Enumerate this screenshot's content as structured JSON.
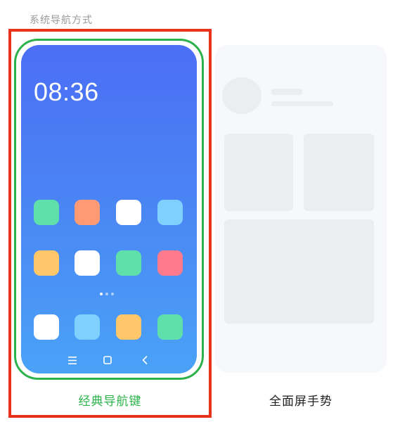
{
  "header": {
    "section_title": "系统导航方式"
  },
  "options": {
    "classic": {
      "label": "经典导航键",
      "selected": true,
      "preview": {
        "clock": "08:36",
        "app_colors_row1": [
          "#5fe0ab",
          "#ff9a74",
          "#ffffff",
          "#7fd0ff"
        ],
        "app_colors_row2": [
          "#ffc66a",
          "#ffffff",
          "#5fe0ab",
          "#ff7a8c"
        ],
        "app_colors_dock": [
          "#ffffff",
          "#7fd0ff",
          "#ffc66a",
          "#5fe0ab"
        ],
        "nav_icons": [
          "menu-icon",
          "home-square-icon",
          "back-chevron-icon"
        ]
      }
    },
    "gesture": {
      "label": "全面屏手势",
      "selected": false
    }
  },
  "colors": {
    "accent_selected": "#2bb24a",
    "highlight_box": "#e8321c",
    "screen_gradient_top": "#4b6ef5",
    "screen_gradient_bottom": "#4aa2f6"
  }
}
